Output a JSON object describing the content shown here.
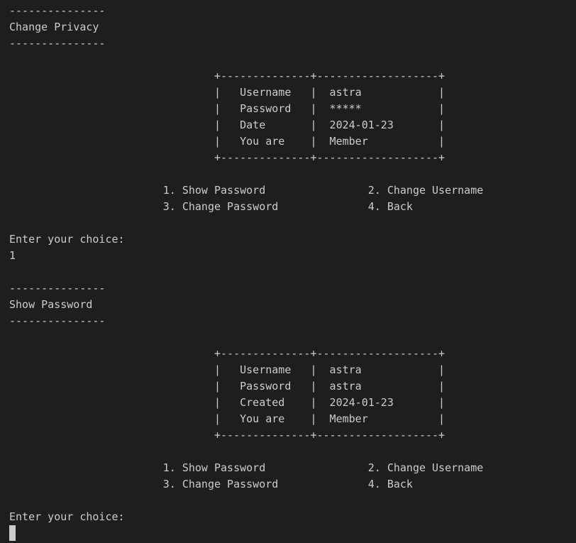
{
  "lines": [
    "---------------",
    "Change Privacy",
    "---------------",
    "",
    "",
    "                                +--------------+-------------------+",
    "                                |   Username   |  astra            |",
    "                                |   Password   |  *****            |",
    "                                |   Date       |  2024-01-23       |",
    "                                |   You are    |  Member           |",
    "                                +--------------+-------------------+",
    "",
    "                        1. Show Password                2. Change Username",
    "                        3. Change Password              4. Back",
    "",
    "Enter your choice:",
    "1",
    "",
    "---------------",
    "Show Password",
    "---------------",
    "",
    "",
    "                                +--------------+-------------------+",
    "                                |   Username   |  astra            |",
    "                                |   Password   |  astra            |",
    "                                |   Created    |  2024-01-23       |",
    "                                |   You are    |  Member           |",
    "                                +--------------+-------------------+",
    "",
    "                        1. Show Password                2. Change Username",
    "                        3. Change Password              4. Back",
    "",
    "Enter your choice:"
  ]
}
